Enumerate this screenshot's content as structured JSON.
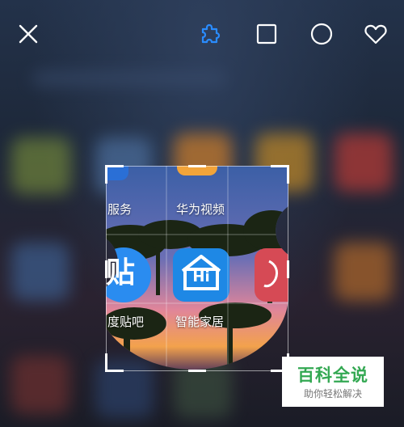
{
  "toolbar": {
    "icons": [
      "close-icon",
      "puzzle-icon",
      "square-icon",
      "circle-icon",
      "heart-icon"
    ],
    "accent_color": "#2a8cff",
    "icon_color": "#ffffff"
  },
  "apps": {
    "top_left_label": "服务",
    "top_center_label": "华为视频",
    "tieba_label": "度贴吧",
    "tieba_icon_glyph": "贴",
    "smarthome_label": "智能家居",
    "smarthome_icon_text": "Hi",
    "tieba_color": "#2a8cf0",
    "smarthome_color": "#1e88e5",
    "right_app_color": "#d64a55"
  },
  "watermark": {
    "brand": "百科全说",
    "slogan": "助你轻松解决",
    "brand_color": "#33a852"
  }
}
